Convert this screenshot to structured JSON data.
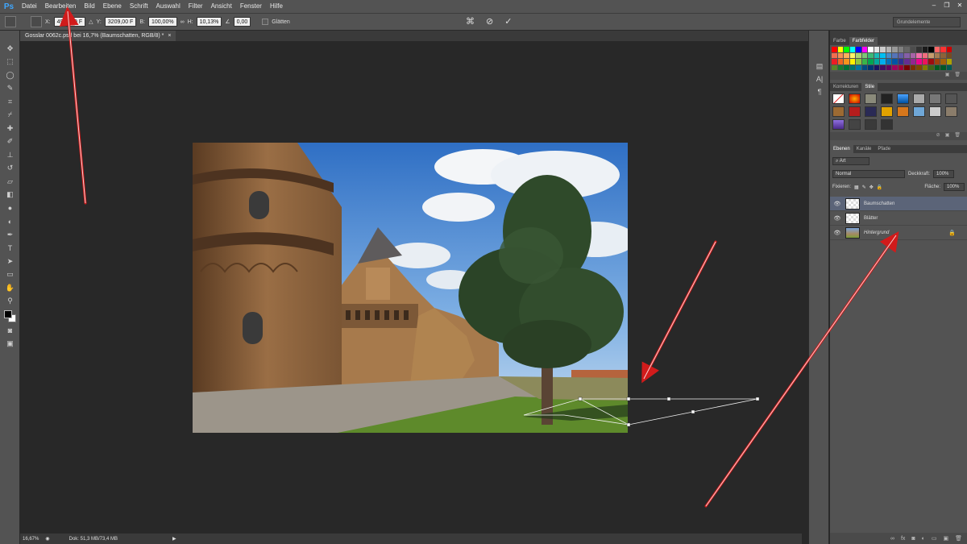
{
  "menubar": {
    "logo": "Ps",
    "items": [
      "Datei",
      "Bearbeiten",
      "Bild",
      "Ebene",
      "Schrift",
      "Auswahl",
      "Filter",
      "Ansicht",
      "Fenster",
      "Hilfe"
    ],
    "window_controls": [
      "–",
      "❐",
      "✕"
    ]
  },
  "options": {
    "x_label": "X:",
    "x_value": "4925,50 F",
    "y_label": "Y:",
    "y_value": "3209,00 F",
    "b_label": "B:",
    "b_value": "100,00%",
    "h_label": "H:",
    "h_value": "10,13%",
    "angle_value": "0,00",
    "smoothing_label": "Glätten",
    "cancel_glyph": "⊘",
    "commit_glyph": "✓",
    "warp_glyph": "⌘",
    "workspace": "Grundelemente"
  },
  "document": {
    "tab_title": "Gosslar 0062c.psd bei 16,7% (Baumschatten, RGB/8) *",
    "close_glyph": "×"
  },
  "status": {
    "zoom": "16,67%",
    "doc_info": "Dok: 51,3 MB/73,4 MB"
  },
  "panels": {
    "color_tabs": [
      "Farbe",
      "Farbfelder"
    ],
    "adjust_tabs": [
      "Korrekturen",
      "Stile"
    ],
    "layer_tabs": [
      "Ebenen",
      "Kanäle",
      "Pfade"
    ],
    "filter_kind": "Art",
    "blend_mode": "Normal",
    "opacity_label": "Deckkraft:",
    "opacity_value": "100%",
    "lock_label": "Fixieren:",
    "fill_label": "Fläche:",
    "fill_value": "100%"
  },
  "layers": [
    {
      "name": "Baumschatten",
      "selected": true,
      "kind": "trans"
    },
    {
      "name": "Blätter",
      "selected": false,
      "kind": "trans"
    },
    {
      "name": "Hintergrund",
      "selected": false,
      "kind": "photo"
    }
  ],
  "colors": {
    "accent": "#3fa7ff",
    "panel_bg": "#535353",
    "canvas_bg": "#282828",
    "arrow": "#d11b1b",
    "layer_selected": "#5b6478"
  }
}
